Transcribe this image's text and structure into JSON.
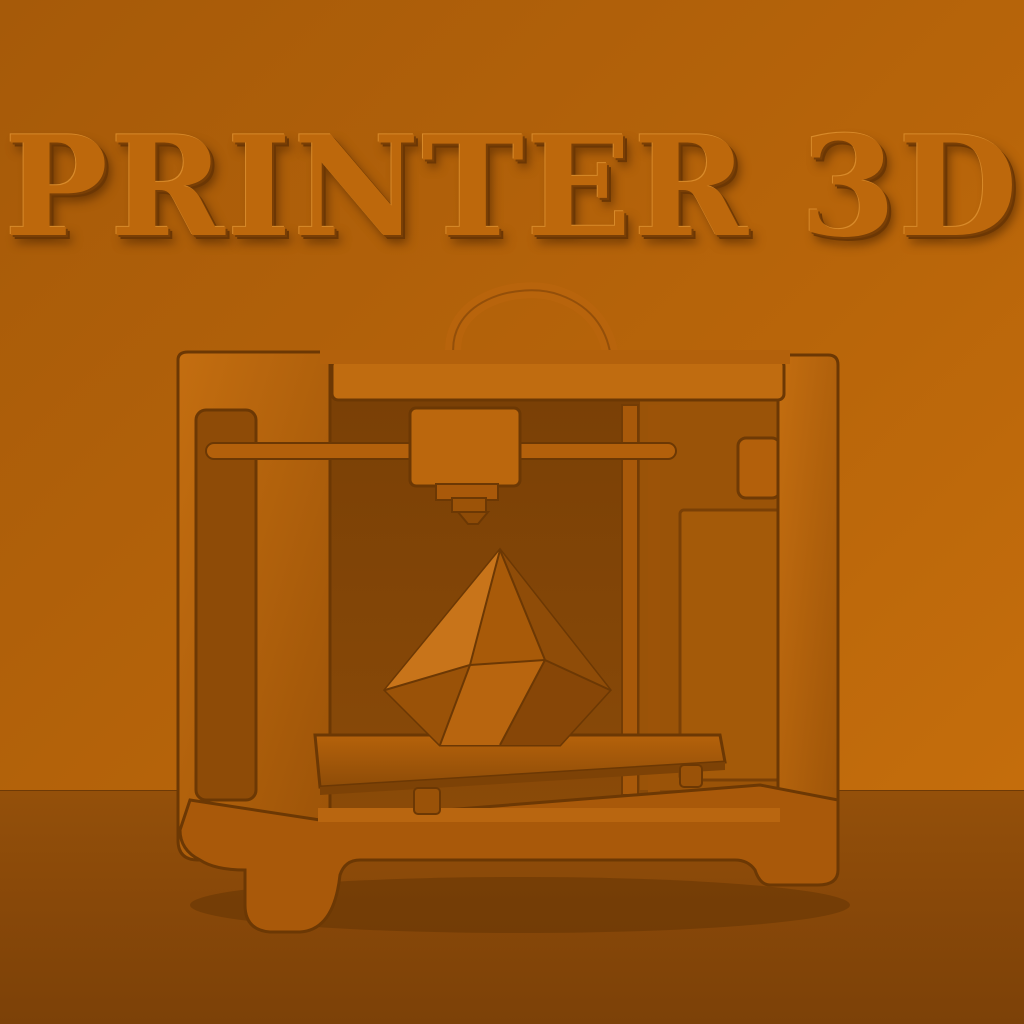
{
  "title": "PRINTER 3D",
  "colors": {
    "background": "#b8650a",
    "printer_body": "#b2600a",
    "printer_shadow": "#6f3a05",
    "accent_highlight": "#d2801f"
  },
  "icons": [
    "3d-printer-icon",
    "diamond-print-object",
    "print-head-icon"
  ]
}
